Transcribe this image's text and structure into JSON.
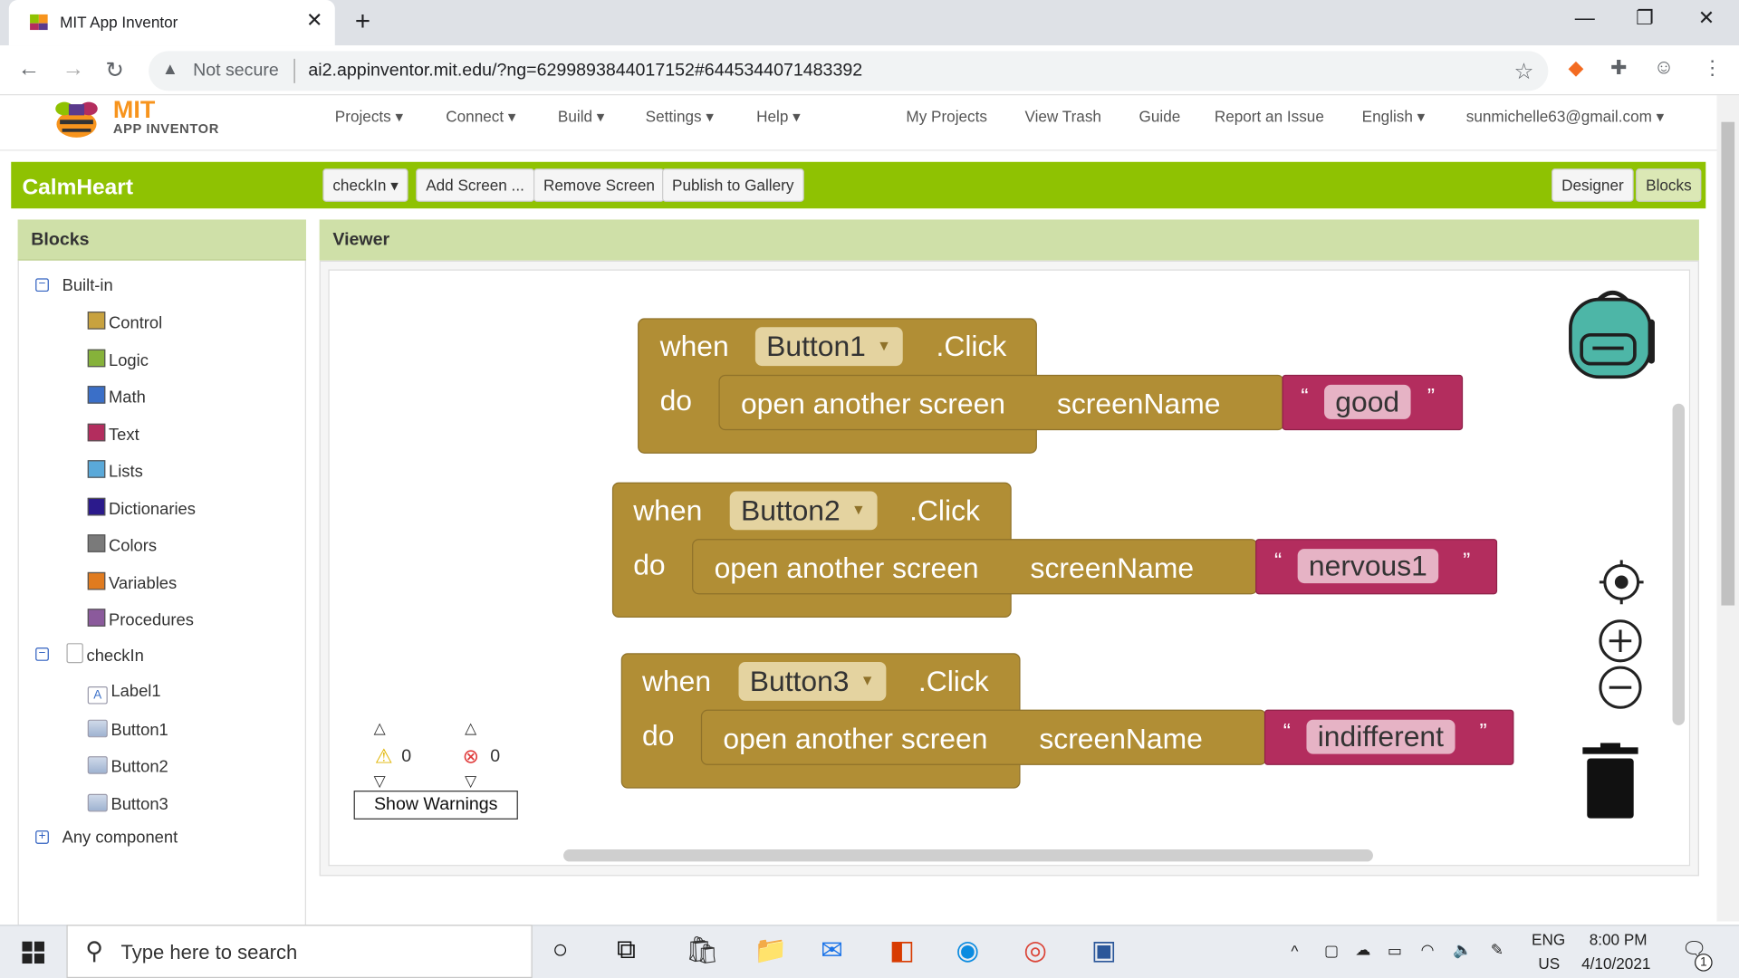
{
  "browser": {
    "tab_title": "MIT App Inventor",
    "tab_close": "✕",
    "new_tab": "+",
    "security_label": "Not secure",
    "url": "ai2.appinventor.mit.edu/?ng=6299893844017152#6445344071483392",
    "window_controls": [
      "—",
      "❐",
      "✕"
    ]
  },
  "app": {
    "logo_mit": "MIT",
    "logo_sub": "APP INVENTOR",
    "menu_left": [
      "Projects ▾",
      "Connect ▾",
      "Build ▾",
      "Settings ▾",
      "Help ▾"
    ],
    "menu_right": [
      "My Projects",
      "View Trash",
      "Guide",
      "Report an Issue",
      "English ▾",
      "sunmichelle63@gmail.com ▾"
    ],
    "project_name": "CalmHeart",
    "screen_select": "checkIn ▾",
    "toolbar_buttons": [
      "Add Screen ...",
      "Remove Screen",
      "Publish to Gallery"
    ],
    "designer_label": "Designer",
    "blocks_label": "Blocks"
  },
  "blocks_panel": {
    "title": "Blocks",
    "builtin_label": "Built-in",
    "builtin": [
      {
        "label": "Control",
        "color": "#c8a23f"
      },
      {
        "label": "Logic",
        "color": "#86b23a"
      },
      {
        "label": "Math",
        "color": "#3a6fc8"
      },
      {
        "label": "Text",
        "color": "#b32d5e"
      },
      {
        "label": "Lists",
        "color": "#5aa9d9"
      },
      {
        "label": "Dictionaries",
        "color": "#2b1a8c"
      },
      {
        "label": "Colors",
        "color": "#7a7a7a"
      },
      {
        "label": "Variables",
        "color": "#e07b1f"
      },
      {
        "label": "Procedures",
        "color": "#8b5a9c"
      }
    ],
    "screen_label": "checkIn",
    "components": [
      "Label1",
      "Button1",
      "Button2",
      "Button3"
    ],
    "any_component": "Any component"
  },
  "viewer": {
    "title": "Viewer",
    "events": [
      {
        "when": "when",
        "component": "Button1",
        "event": ".Click",
        "do": "do",
        "call": "open another screen",
        "param": "screenName",
        "value": "good"
      },
      {
        "when": "when",
        "component": "Button2",
        "event": ".Click",
        "do": "do",
        "call": "open another screen",
        "param": "screenName",
        "value": "nervous1"
      },
      {
        "when": "when",
        "component": "Button3",
        "event": ".Click",
        "do": "do",
        "call": "open another screen",
        "param": "screenName",
        "value": "indifferent"
      }
    ],
    "warnings_count": "0",
    "errors_count": "0",
    "show_warnings": "Show Warnings",
    "open_quote": "“",
    "close_quote": "”"
  },
  "taskbar": {
    "search_placeholder": "Type here to search",
    "lang_top": "ENG",
    "lang_bottom": "US",
    "time": "8:00 PM",
    "date": "4/10/2021",
    "notif_count": "1"
  }
}
